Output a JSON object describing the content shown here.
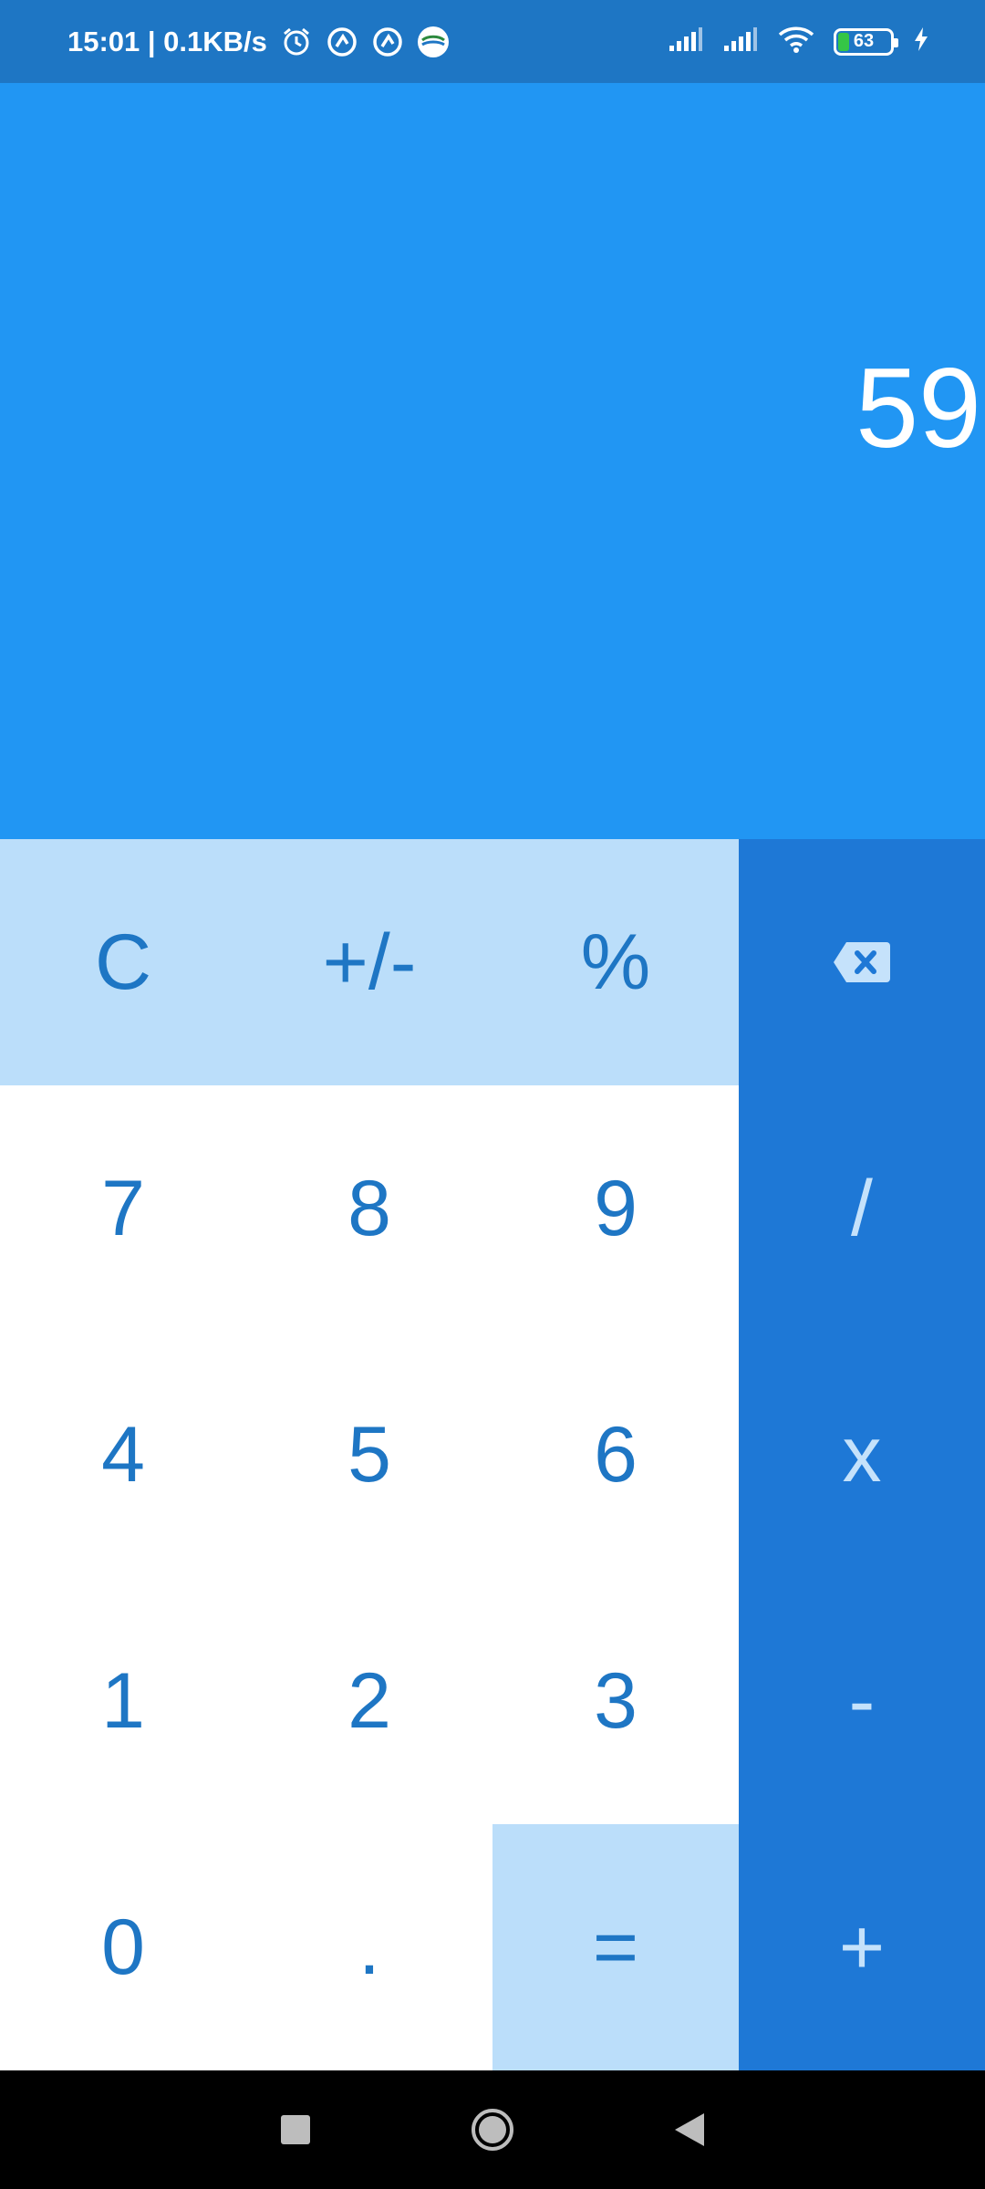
{
  "status_bar": {
    "time_speed": "15:01 | 0.1KB/s",
    "battery": "63",
    "icons": [
      "alarm-icon",
      "app-icon",
      "app-icon",
      "bmkg-icon",
      "signal-icon",
      "signal-icon",
      "wifi-icon",
      "battery-icon",
      "charging-icon"
    ]
  },
  "display": {
    "value": "59"
  },
  "keys": {
    "clear": "C",
    "sign": "+/-",
    "percent": "%",
    "seven": "7",
    "eight": "8",
    "nine": "9",
    "divide": "/",
    "four": "4",
    "five": "5",
    "six": "6",
    "multiply": "x",
    "one": "1",
    "two": "2",
    "three": "3",
    "minus": "-",
    "zero": "0",
    "dot": ".",
    "equals": "=",
    "plus": "+"
  },
  "colors": {
    "status_bar": "#1E76C4",
    "display_bg": "#2196F3",
    "light_key": "#BBDEFA",
    "operator_col": "#1E78D6",
    "key_text": "#1E76C4"
  }
}
